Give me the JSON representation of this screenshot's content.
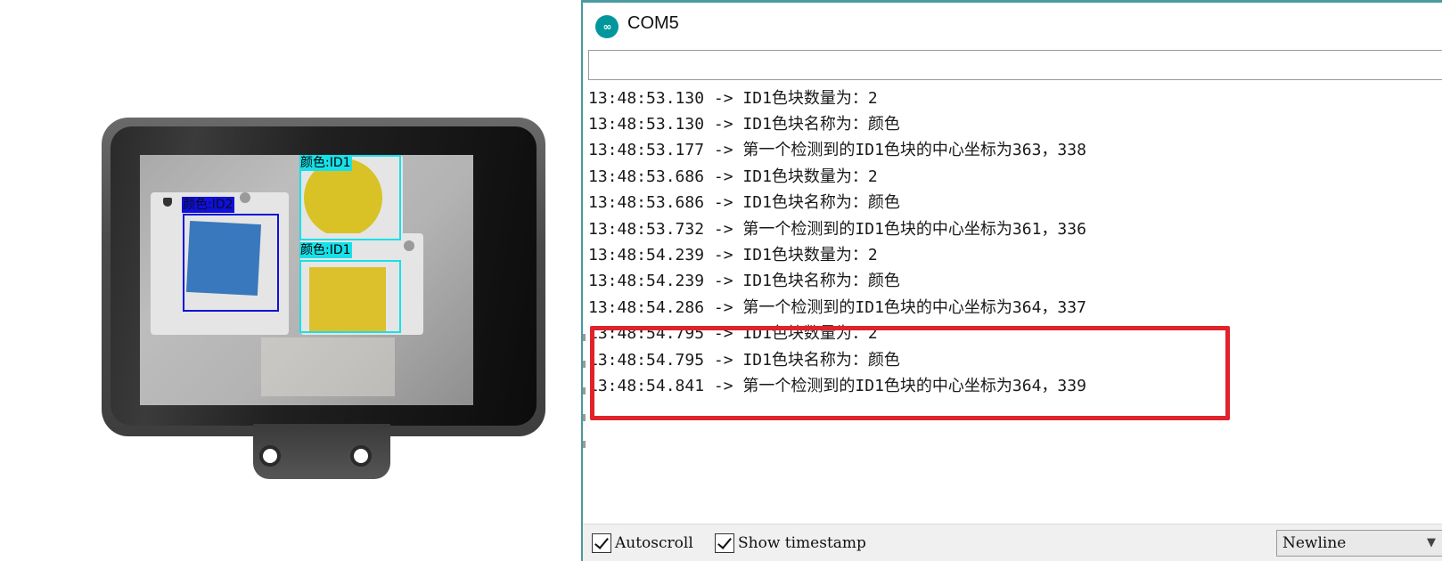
{
  "camera": {
    "detections": [
      {
        "label": "颜色:ID2",
        "color": "#1010d8"
      },
      {
        "label": "颜色:ID1",
        "color": "#18e0e8"
      },
      {
        "label": "颜色:ID1",
        "color": "#18e0e8"
      }
    ]
  },
  "serial_monitor": {
    "window_title": "COM5",
    "send_input_value": "",
    "log_lines": [
      "13:48:53.130 -> ID1色块数量为：2",
      "13:48:53.130 -> ID1色块名称为：颜色",
      "13:48:53.177 -> 第一个检测到的ID1色块的中心坐标为363，338",
      "13:48:53.686 -> ID1色块数量为：2",
      "13:48:53.686 -> ID1色块名称为：颜色",
      "13:48:53.732 -> 第一个检测到的ID1色块的中心坐标为361，336",
      "13:48:54.239 -> ID1色块数量为：2",
      "13:48:54.239 -> ID1色块名称为：颜色",
      "13:48:54.286 -> 第一个检测到的ID1色块的中心坐标为364，337",
      "13:48:54.795 -> ID1色块数量为：2",
      "13:48:54.795 -> ID1色块名称为：颜色",
      "13:48:54.841 -> 第一个检测到的ID1色块的中心坐标为364，339"
    ],
    "highlight_color": "#e0222a",
    "autoscroll_label": "Autoscroll",
    "autoscroll_checked": true,
    "timestamp_label": "Show timestamp",
    "timestamp_checked": true,
    "line_ending": "Newline"
  }
}
